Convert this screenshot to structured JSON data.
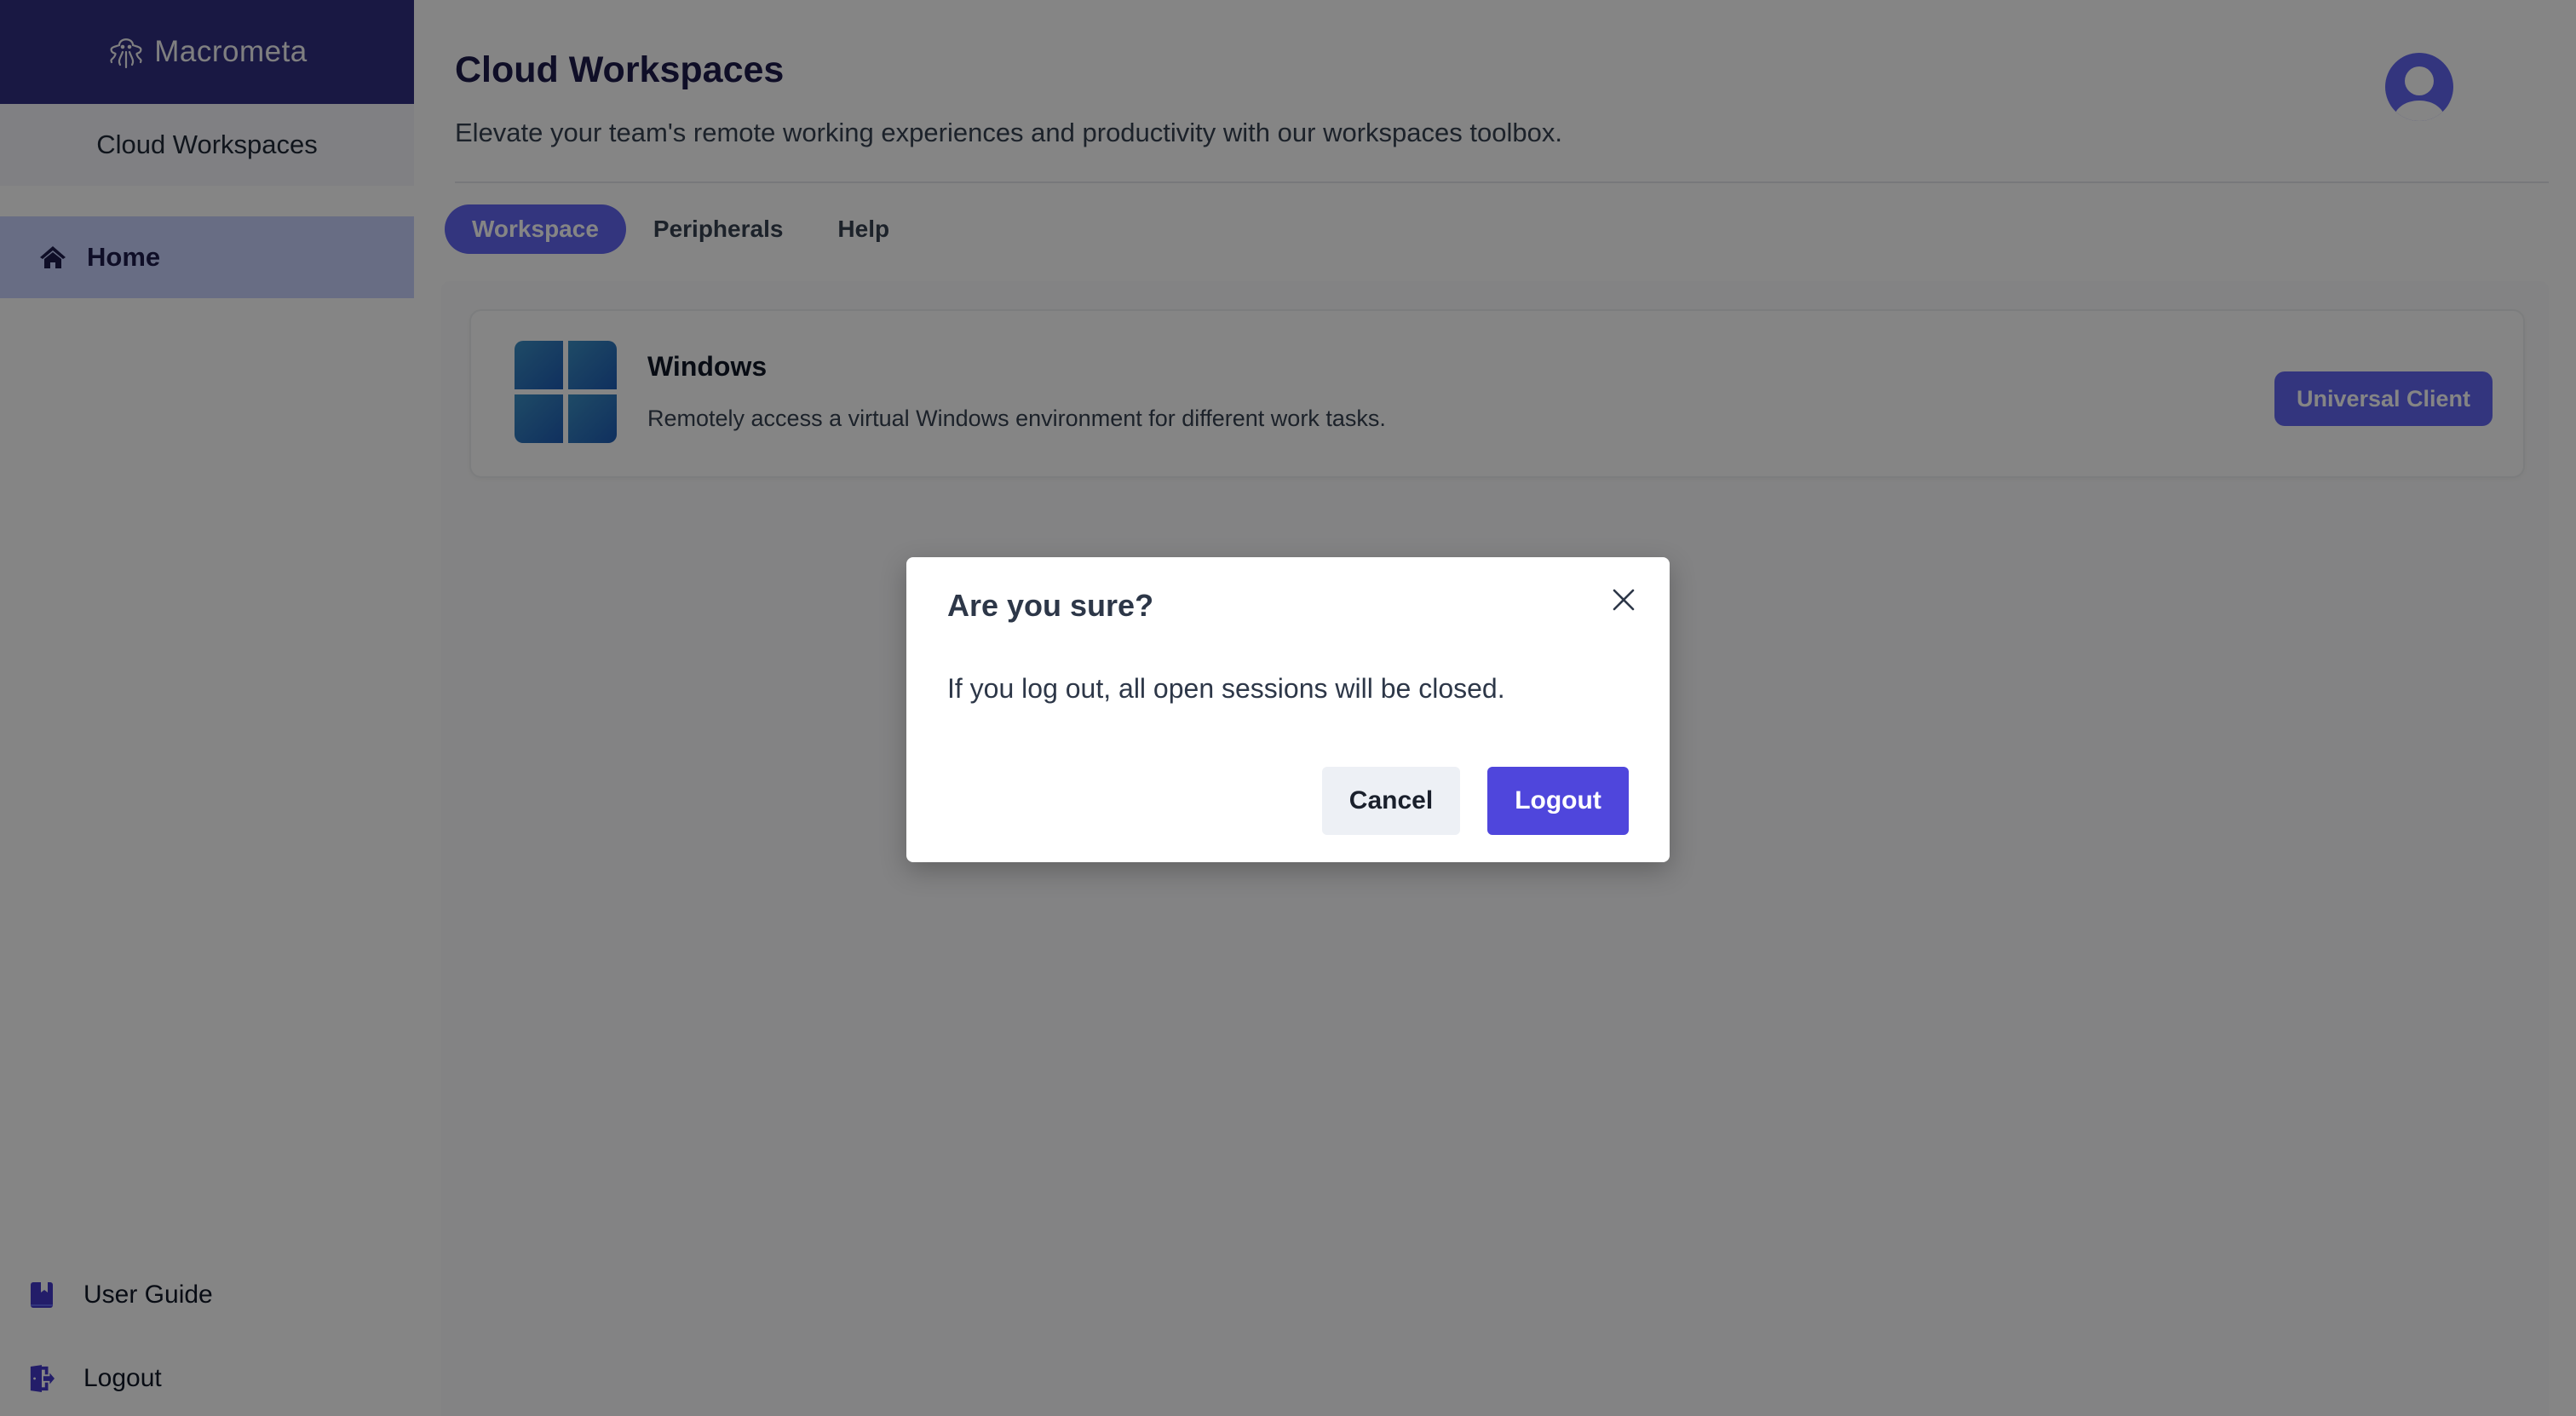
{
  "brand": {
    "name": "Macrometa",
    "logo_icon": "octopus-icon"
  },
  "sidebar": {
    "app_name": "Cloud Workspaces",
    "nav": [
      {
        "label": "Home",
        "icon": "home-icon",
        "active": true
      }
    ],
    "bottom": [
      {
        "label": "User Guide",
        "icon": "book-icon"
      },
      {
        "label": "Logout",
        "icon": "logout-door-icon"
      }
    ]
  },
  "header": {
    "title": "Cloud Workspaces",
    "subtitle": "Elevate your team's remote working experiences and productivity with our workspaces toolbox.",
    "avatar_icon": "user-avatar-icon"
  },
  "tabs": [
    {
      "label": "Workspace",
      "active": true
    },
    {
      "label": "Peripherals",
      "active": false
    },
    {
      "label": "Help",
      "active": false
    }
  ],
  "workspaces": [
    {
      "title": "Windows",
      "description": "Remotely access a virtual Windows environment for different work tasks.",
      "icon": "windows-logo-icon",
      "action_label": "Universal Client"
    }
  ],
  "modal": {
    "title": "Are you sure?",
    "body": "If you log out, all open sessions will be closed.",
    "cancel_label": "Cancel",
    "confirm_label": "Logout",
    "close_icon": "close-icon"
  },
  "colors": {
    "brand_dark": "#312e81",
    "accent": "#6366f1",
    "nav_active": "#c7d2fe",
    "confirm_button": "#4f46dc",
    "cancel_button": "#edf0f5"
  }
}
